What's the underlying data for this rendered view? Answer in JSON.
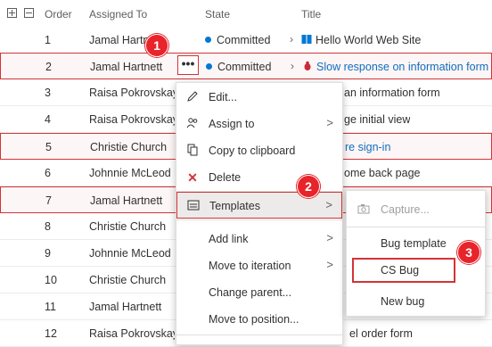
{
  "header": {
    "order_label": "Order",
    "assigned_label": "Assigned To",
    "state_label": "State",
    "title_label": "Title"
  },
  "rows": [
    {
      "order": "1",
      "assigned": "Jamal Hartnett",
      "state": "Committed",
      "title": "Hello World Web Site"
    },
    {
      "order": "2",
      "assigned": "Jamal Hartnett",
      "state": "Committed",
      "title": "Slow response on information form"
    },
    {
      "order": "3",
      "assigned": "Raisa Pokrovskaya",
      "title": "an information form"
    },
    {
      "order": "4",
      "assigned": "Raisa Pokrovskaya",
      "title": "ge initial view"
    },
    {
      "order": "5",
      "assigned": "Christie Church",
      "title": "re sign-in"
    },
    {
      "order": "6",
      "assigned": "Johnnie McLeod",
      "title": "ome back page"
    },
    {
      "order": "7",
      "assigned": "Jamal Hartnett",
      "title": ""
    },
    {
      "order": "8",
      "assigned": "Christie Church",
      "title": ""
    },
    {
      "order": "9",
      "assigned": "Johnnie McLeod",
      "title": ""
    },
    {
      "order": "10",
      "assigned": "Christie Church",
      "title": ""
    },
    {
      "order": "11",
      "assigned": "Jamal Hartnett",
      "title": ""
    },
    {
      "order": "12",
      "assigned": "Raisa Pokrovskaya",
      "title": "el order form"
    }
  ],
  "actions_button": "•••",
  "context_menu": {
    "items": [
      {
        "label": "Edit...",
        "icon": "pencil-icon"
      },
      {
        "label": "Assign to",
        "icon": "people-icon"
      },
      {
        "label": "Copy to clipboard",
        "icon": "copy-icon"
      },
      {
        "label": "Delete",
        "icon": "x-icon"
      },
      {
        "label": "Templates",
        "icon": "template-icon"
      },
      {
        "label": "Add link"
      },
      {
        "label": "Move to iteration"
      },
      {
        "label": "Change parent..."
      },
      {
        "label": "Move to position..."
      }
    ]
  },
  "submenu": {
    "capture": "Capture...",
    "bug_template": "Bug template",
    "cs_bug": "CS Bug",
    "new_bug": "New bug"
  },
  "badges": {
    "one": "1",
    "two": "2",
    "three": "3"
  },
  "colors": {
    "accent": "#0078d4",
    "highlight": "#d13438",
    "link": "#106ebe"
  }
}
